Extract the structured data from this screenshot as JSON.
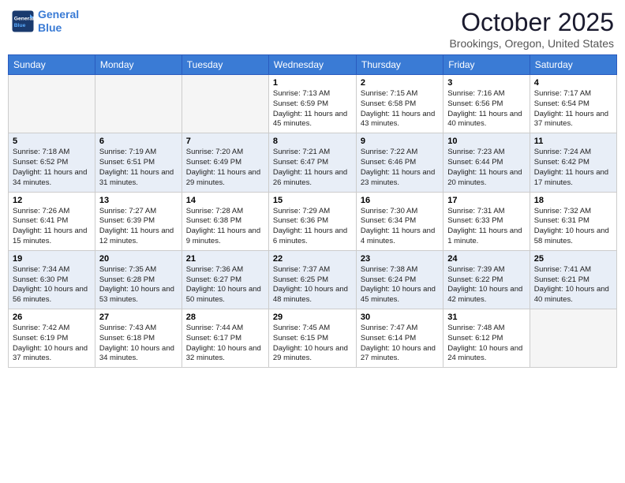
{
  "header": {
    "logo_line1": "General",
    "logo_line2": "Blue",
    "month": "October 2025",
    "location": "Brookings, Oregon, United States"
  },
  "days_of_week": [
    "Sunday",
    "Monday",
    "Tuesday",
    "Wednesday",
    "Thursday",
    "Friday",
    "Saturday"
  ],
  "weeks": [
    {
      "shaded": false,
      "days": [
        {
          "num": "",
          "content": ""
        },
        {
          "num": "",
          "content": ""
        },
        {
          "num": "",
          "content": ""
        },
        {
          "num": "1",
          "content": "Sunrise: 7:13 AM\nSunset: 6:59 PM\nDaylight: 11 hours and 45 minutes."
        },
        {
          "num": "2",
          "content": "Sunrise: 7:15 AM\nSunset: 6:58 PM\nDaylight: 11 hours and 43 minutes."
        },
        {
          "num": "3",
          "content": "Sunrise: 7:16 AM\nSunset: 6:56 PM\nDaylight: 11 hours and 40 minutes."
        },
        {
          "num": "4",
          "content": "Sunrise: 7:17 AM\nSunset: 6:54 PM\nDaylight: 11 hours and 37 minutes."
        }
      ]
    },
    {
      "shaded": true,
      "days": [
        {
          "num": "5",
          "content": "Sunrise: 7:18 AM\nSunset: 6:52 PM\nDaylight: 11 hours and 34 minutes."
        },
        {
          "num": "6",
          "content": "Sunrise: 7:19 AM\nSunset: 6:51 PM\nDaylight: 11 hours and 31 minutes."
        },
        {
          "num": "7",
          "content": "Sunrise: 7:20 AM\nSunset: 6:49 PM\nDaylight: 11 hours and 29 minutes."
        },
        {
          "num": "8",
          "content": "Sunrise: 7:21 AM\nSunset: 6:47 PM\nDaylight: 11 hours and 26 minutes."
        },
        {
          "num": "9",
          "content": "Sunrise: 7:22 AM\nSunset: 6:46 PM\nDaylight: 11 hours and 23 minutes."
        },
        {
          "num": "10",
          "content": "Sunrise: 7:23 AM\nSunset: 6:44 PM\nDaylight: 11 hours and 20 minutes."
        },
        {
          "num": "11",
          "content": "Sunrise: 7:24 AM\nSunset: 6:42 PM\nDaylight: 11 hours and 17 minutes."
        }
      ]
    },
    {
      "shaded": false,
      "days": [
        {
          "num": "12",
          "content": "Sunrise: 7:26 AM\nSunset: 6:41 PM\nDaylight: 11 hours and 15 minutes."
        },
        {
          "num": "13",
          "content": "Sunrise: 7:27 AM\nSunset: 6:39 PM\nDaylight: 11 hours and 12 minutes."
        },
        {
          "num": "14",
          "content": "Sunrise: 7:28 AM\nSunset: 6:38 PM\nDaylight: 11 hours and 9 minutes."
        },
        {
          "num": "15",
          "content": "Sunrise: 7:29 AM\nSunset: 6:36 PM\nDaylight: 11 hours and 6 minutes."
        },
        {
          "num": "16",
          "content": "Sunrise: 7:30 AM\nSunset: 6:34 PM\nDaylight: 11 hours and 4 minutes."
        },
        {
          "num": "17",
          "content": "Sunrise: 7:31 AM\nSunset: 6:33 PM\nDaylight: 11 hours and 1 minute."
        },
        {
          "num": "18",
          "content": "Sunrise: 7:32 AM\nSunset: 6:31 PM\nDaylight: 10 hours and 58 minutes."
        }
      ]
    },
    {
      "shaded": true,
      "days": [
        {
          "num": "19",
          "content": "Sunrise: 7:34 AM\nSunset: 6:30 PM\nDaylight: 10 hours and 56 minutes."
        },
        {
          "num": "20",
          "content": "Sunrise: 7:35 AM\nSunset: 6:28 PM\nDaylight: 10 hours and 53 minutes."
        },
        {
          "num": "21",
          "content": "Sunrise: 7:36 AM\nSunset: 6:27 PM\nDaylight: 10 hours and 50 minutes."
        },
        {
          "num": "22",
          "content": "Sunrise: 7:37 AM\nSunset: 6:25 PM\nDaylight: 10 hours and 48 minutes."
        },
        {
          "num": "23",
          "content": "Sunrise: 7:38 AM\nSunset: 6:24 PM\nDaylight: 10 hours and 45 minutes."
        },
        {
          "num": "24",
          "content": "Sunrise: 7:39 AM\nSunset: 6:22 PM\nDaylight: 10 hours and 42 minutes."
        },
        {
          "num": "25",
          "content": "Sunrise: 7:41 AM\nSunset: 6:21 PM\nDaylight: 10 hours and 40 minutes."
        }
      ]
    },
    {
      "shaded": false,
      "days": [
        {
          "num": "26",
          "content": "Sunrise: 7:42 AM\nSunset: 6:19 PM\nDaylight: 10 hours and 37 minutes."
        },
        {
          "num": "27",
          "content": "Sunrise: 7:43 AM\nSunset: 6:18 PM\nDaylight: 10 hours and 34 minutes."
        },
        {
          "num": "28",
          "content": "Sunrise: 7:44 AM\nSunset: 6:17 PM\nDaylight: 10 hours and 32 minutes."
        },
        {
          "num": "29",
          "content": "Sunrise: 7:45 AM\nSunset: 6:15 PM\nDaylight: 10 hours and 29 minutes."
        },
        {
          "num": "30",
          "content": "Sunrise: 7:47 AM\nSunset: 6:14 PM\nDaylight: 10 hours and 27 minutes."
        },
        {
          "num": "31",
          "content": "Sunrise: 7:48 AM\nSunset: 6:12 PM\nDaylight: 10 hours and 24 minutes."
        },
        {
          "num": "",
          "content": ""
        }
      ]
    }
  ]
}
